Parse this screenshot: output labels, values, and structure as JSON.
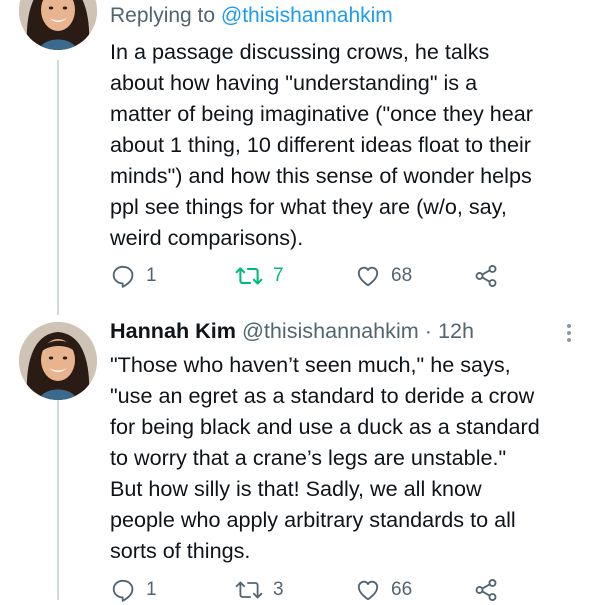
{
  "reply_context": {
    "prefix": "Replying to",
    "handle": "@thisishannahkim"
  },
  "tweet1": {
    "text": "In a passage discussing crows, he talks\nabout how having \"understanding\" is a\nmatter of being imaginative (\"once they hear\nabout 1 thing, 10 different ideas float to their\nminds\") and how this sense of wonder helps\nppl see things for what they are (w/o, say,\nweird comparisons).",
    "replies": "1",
    "retweets": "7",
    "likes": "68"
  },
  "tweet2": {
    "author_name": "Hannah Kim",
    "author_handle": "@thisishannahkim",
    "separator": "·",
    "time": "12h",
    "text": "\"Those who haven’t seen much,\" he says,\n\"use an egret as a standard to deride a crow\nfor being black and use a duck as a standard\nto worry that a crane’s legs are unstable.\"\nBut how silly is that! Sadly, we all know\npeople who apply arbitrary standards to all\nsorts of things.",
    "replies": "1",
    "retweets": "3",
    "likes": "66"
  },
  "colors": {
    "accent": "#1d9bf0",
    "retweet_active": "#00ba7c",
    "muted_text": "#536471",
    "thread_line": "#cfd9de"
  },
  "icons": [
    "reply-icon",
    "retweet-icon",
    "like-icon",
    "share-icon",
    "more-icon"
  ]
}
